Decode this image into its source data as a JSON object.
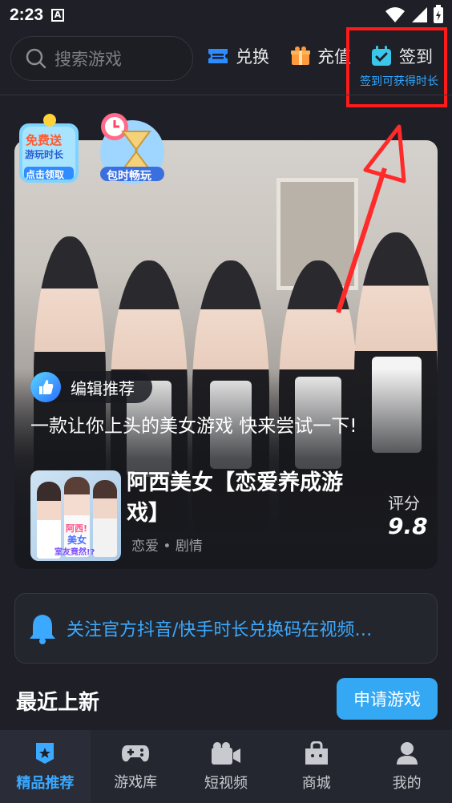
{
  "status_bar": {
    "time": "2:23",
    "notification_icon": "A"
  },
  "header": {
    "search_placeholder": "搜索游戏",
    "redeem_label": "兑换",
    "recharge_label": "充值",
    "checkin_label": "签到",
    "checkin_hint": "签到可获得时长"
  },
  "banner": {
    "badge_free": [
      "免费送",
      "游玩时长",
      "点击领取"
    ],
    "badge_unlimited": "包时畅玩",
    "editor_tag": "编辑推荐",
    "tagline": "一款让你上头的美女游戏 快来尝试一下!",
    "game": {
      "title": "阿西美女【恋爱养成游戏】",
      "tags": "恋爱 • 剧情",
      "score_label": "评分",
      "score": "9.8",
      "cover_text": [
        "阿西!",
        "美女",
        "室友竟然!?"
      ]
    }
  },
  "notice": {
    "text": "关注官方抖音/快手时长兑换码在视频…"
  },
  "recent": {
    "title": "最近上新",
    "apply_button": "申请游戏"
  },
  "tabs": [
    {
      "label": "精品推荐",
      "icon": "star-badge-icon",
      "active": true
    },
    {
      "label": "游戏库",
      "icon": "gamepad-icon",
      "active": false
    },
    {
      "label": "短视频",
      "icon": "video-camera-icon",
      "active": false
    },
    {
      "label": "商城",
      "icon": "shop-icon",
      "active": false
    },
    {
      "label": "我的",
      "icon": "user-icon",
      "active": false
    }
  ],
  "colors": {
    "accent": "#3aa9ff",
    "background": "#1f2027",
    "highlight_box": "#ff1a1a"
  }
}
